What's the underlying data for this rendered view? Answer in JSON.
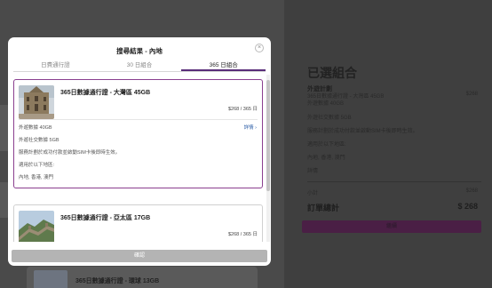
{
  "modal": {
    "title": "搜尋結果 - 內地",
    "tabs": [
      {
        "label": "日費通行證",
        "active": false
      },
      {
        "label": "30 日組合",
        "active": false
      },
      {
        "label": "365 日組合",
        "active": true
      }
    ],
    "cards": [
      {
        "name": "365日數據通行證 - 大灣區 45GB",
        "price": "$268 / 365 日",
        "selected": true,
        "data_line": "外遊數據 40GB",
        "detail_label": "詳情",
        "social_line": "外遊社交數據 5GB",
        "activation": "服務計劃於成功付款並啟動SIM卡後即時生效。",
        "regions_label": "適用於以下地區:",
        "regions": "內地, 香港, 澳門"
      },
      {
        "name": "365日數據通行證 - 亞太區 17GB",
        "price": "$268 / 365 日",
        "selected": false
      }
    ],
    "confirm_label": "確認"
  },
  "background": {
    "peek_title": "365日數據通行證 - 環球 13GB",
    "selected_title": "已選組合",
    "plan_heading": "外遊計劃",
    "plan_name": "365日數據通行證 - 大灣區 45GB",
    "plan_price": "$268",
    "plan_data": "外遊數據 40GB",
    "social": "外遊社交數據 5GB",
    "activation": "服務計劃於成功付款並啟動SIM卡後即時生效。",
    "regions_label": "適用於以下地區:",
    "regions": "內地, 香港, 澳門",
    "details": "詳情",
    "subtotal_label": "小計",
    "subtotal_value": "$268",
    "total_label": "訂單總計",
    "total_value": "$ 268",
    "button_label": "繼續"
  },
  "colors": {
    "accent": "#5a2e7a",
    "selected_border": "#8a3f8f",
    "link": "#2e5fa8"
  }
}
